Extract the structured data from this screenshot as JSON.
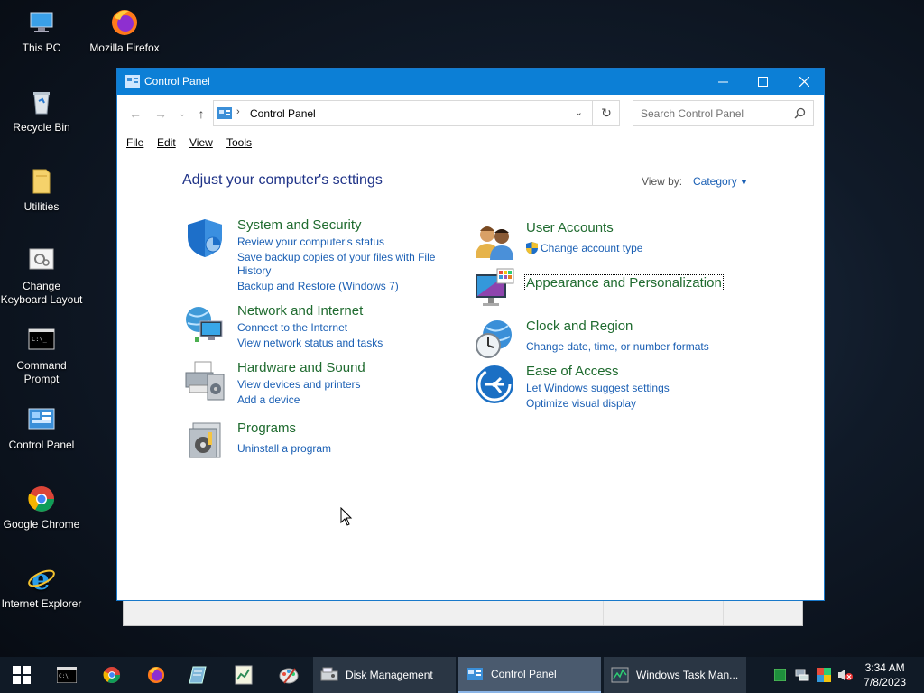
{
  "desktop": {
    "icons": [
      {
        "label": "This PC"
      },
      {
        "label": "Mozilla Firefox"
      },
      {
        "label": "Recycle Bin"
      },
      {
        "label": "Utilities"
      },
      {
        "label": "Change Keyboard Layout"
      },
      {
        "label": "Command Prompt"
      },
      {
        "label": "Control Panel"
      },
      {
        "label": "Google Chrome"
      },
      {
        "label": "Internet Explorer"
      }
    ]
  },
  "window": {
    "title": "Control Panel",
    "address": {
      "crumb": "Control Panel"
    },
    "search": {
      "placeholder": "Search Control Panel"
    },
    "menu": [
      "File",
      "Edit",
      "View",
      "Tools"
    ],
    "heading": "Adjust your computer's settings",
    "view_by_label": "View by:",
    "view_by_value": "Category",
    "categories": [
      {
        "title": "System and Security",
        "links": [
          "Review your computer's status",
          "Save backup copies of your files with File",
          "History",
          "Backup and Restore (Windows 7)"
        ]
      },
      {
        "title": "Network and Internet",
        "links": [
          "Connect to the Internet",
          "View network status and tasks"
        ]
      },
      {
        "title": "Hardware and Sound",
        "links": [
          "View devices and printers",
          "Add a device"
        ]
      },
      {
        "title": "Programs",
        "links": [
          "Uninstall a program"
        ]
      },
      {
        "title": "User Accounts",
        "links": [
          "Change account type"
        ]
      },
      {
        "title": "Appearance and Personalization",
        "links": []
      },
      {
        "title": "Clock and Region",
        "links": [
          "Change date, time, or number formats"
        ]
      },
      {
        "title": "Ease of Access",
        "links": [
          "Let Windows suggest settings",
          "Optimize visual display"
        ]
      }
    ]
  },
  "taskbar": {
    "apps": [
      {
        "label": "Disk Management"
      },
      {
        "label": "Control Panel"
      },
      {
        "label": "Windows Task Man..."
      }
    ],
    "time": "3:34 AM",
    "date": "7/8/2023"
  },
  "colors": {
    "accent": "#0c7fd6",
    "link": "#1a5fb4",
    "category_title": "#1f6b2f",
    "heading": "#1e3287"
  }
}
